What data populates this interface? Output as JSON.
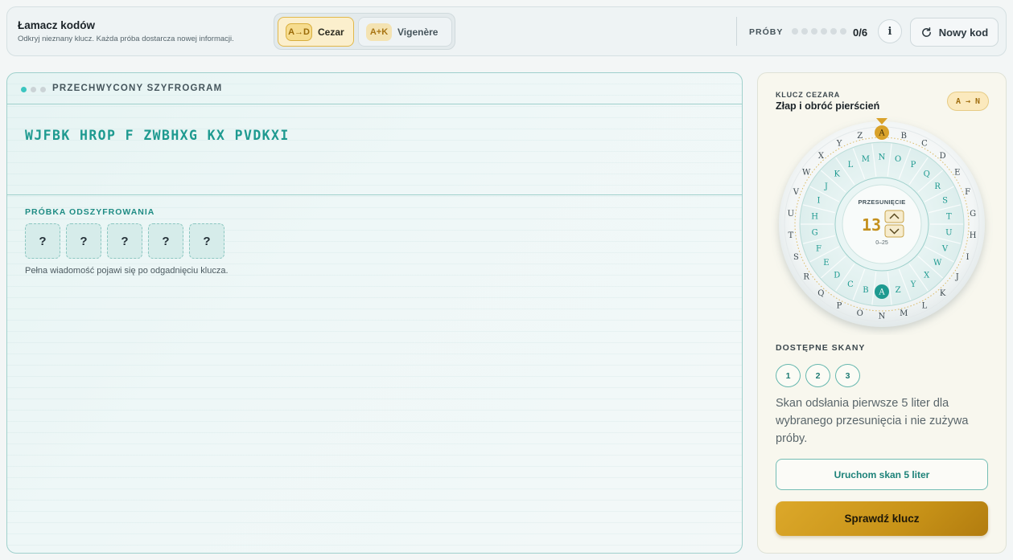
{
  "header": {
    "title": "Łamacz kodów",
    "subtitle": "Odkryj nieznany klucz. Każda próba dostarcza nowej informacji.",
    "modes": [
      {
        "badge": "A→D",
        "label": "Cezar",
        "active": true
      },
      {
        "badge": "A+K",
        "label": "Vigenère",
        "active": false
      }
    ],
    "tries_label": "PRÓBY",
    "tries_total_dots": 6,
    "tries_count": "0/6",
    "info_label": "i",
    "new_code_label": "Nowy kod",
    "new_code_icon": "refresh-icon"
  },
  "cipher": {
    "title": "PRZECHWYCONY SZYFROGRAM",
    "text": "WJFBK HROP F ZWBHXG KX PVDKXI",
    "sample_label": "PRÓBKA ODSZYFROWANIA",
    "sample_tiles": [
      "?",
      "?",
      "?",
      "?",
      "?"
    ],
    "sample_note": "Pełna wiadomość pojawi się po odgadnięciu klucza."
  },
  "key": {
    "label": "KLUCZ CEZARA",
    "title": "Złap i obróć pierścień",
    "badge": "A → N",
    "wheel": {
      "outer_letters": [
        "A",
        "B",
        "C",
        "D",
        "E",
        "F",
        "G",
        "H",
        "I",
        "J",
        "K",
        "L",
        "M",
        "N",
        "O",
        "P",
        "Q",
        "R",
        "S",
        "T",
        "U",
        "V",
        "W",
        "X",
        "Y",
        "Z"
      ],
      "inner_letters": [
        "N",
        "O",
        "P",
        "Q",
        "R",
        "S",
        "T",
        "U",
        "V",
        "W",
        "X",
        "Y",
        "Z",
        "A",
        "B",
        "C",
        "D",
        "E",
        "F",
        "G",
        "H",
        "I",
        "J",
        "K",
        "L",
        "M"
      ],
      "shift_label": "PRZESUNIĘCIE",
      "shift_value": "13",
      "shift_range": "0–25",
      "highlight_outer": "A",
      "highlight_inner": "A"
    },
    "scans_label": "DOSTĘPNE SKANY",
    "scans": [
      "1",
      "2",
      "3"
    ],
    "scan_description": "Skan odsłania pierwsze 5 liter dla wybranego przesunięcia i nie zużywa próby.",
    "scan_button": "Uruchom skan 5 liter",
    "check_button": "Sprawdź klucz"
  },
  "colors": {
    "accent_teal": "#1e9a90",
    "accent_gold": "#d9a22a",
    "panel_border": "#9fd0cc"
  }
}
